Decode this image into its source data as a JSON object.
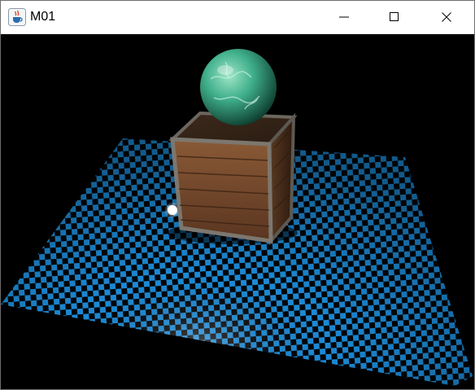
{
  "window": {
    "title": "M01",
    "app_icon": "java-coffee-cup-icon",
    "controls": [
      "minimize-icon",
      "maximize-icon",
      "close-icon"
    ]
  },
  "scene": {
    "background_color": "#000000",
    "floor": {
      "pattern": "checkerboard",
      "colors": [
        "#1e8fdc",
        "#000000"
      ]
    },
    "crate": {
      "material": "wood"
    },
    "sphere": {
      "material": "green-marble",
      "color": "#3fae8a"
    },
    "light": {
      "color": "#ffffff"
    }
  }
}
